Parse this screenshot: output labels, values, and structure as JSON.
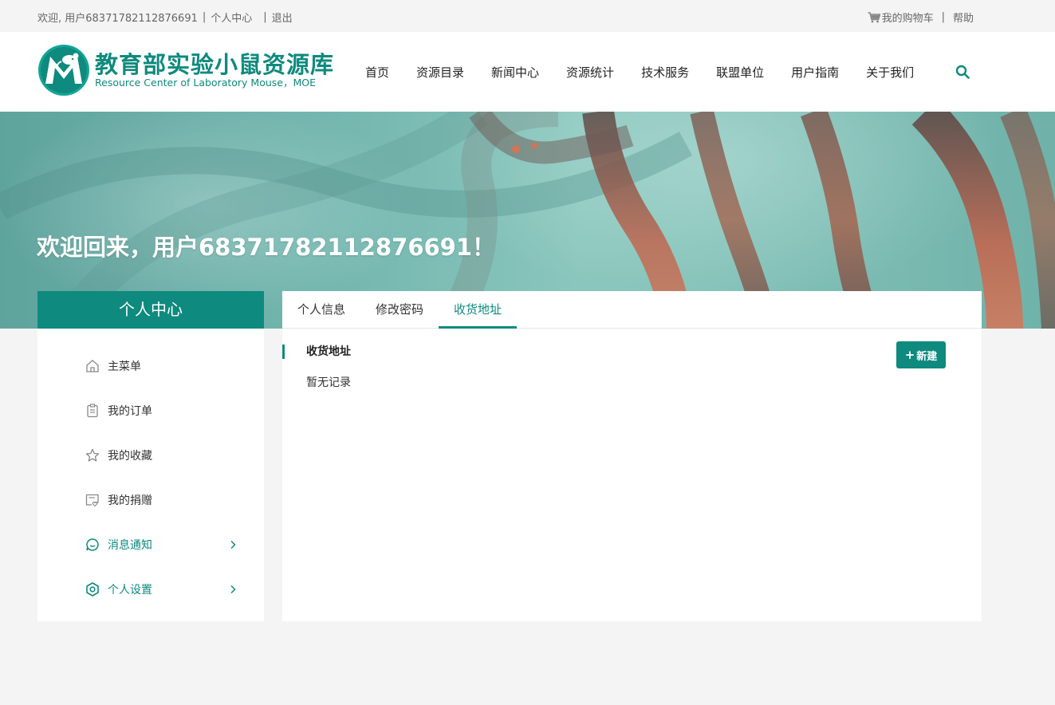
{
  "colors": {
    "accent": "#0e8a7e",
    "page_bg": "#f4f4f4",
    "panel_bg": "#ffffff"
  },
  "topbar": {
    "welcome": "欢迎, 用户68371782112876691",
    "sep": "|",
    "personal_center": "个人中心",
    "logout": "退出",
    "cart_icon": "cart-icon",
    "cart": "我的购物车",
    "help": "帮助"
  },
  "logo": {
    "cn": "教育部实验小鼠资源库",
    "en": "Resource Center of Laboratory Mouse，MOE"
  },
  "nav": {
    "items": [
      {
        "label": "首页"
      },
      {
        "label": "资源目录"
      },
      {
        "label": "新闻中心"
      },
      {
        "label": "资源统计"
      },
      {
        "label": "技术服务"
      },
      {
        "label": "联盟单位"
      },
      {
        "label": "用户指南"
      },
      {
        "label": "关于我们"
      }
    ],
    "search_icon": "search-icon"
  },
  "banner": {
    "title": "欢迎回来，用户68371782112876691！"
  },
  "sidebar": {
    "title": "个人中心",
    "items": [
      {
        "label": "主菜单",
        "icon": "home-icon",
        "highlight": false,
        "has_submenu": false
      },
      {
        "label": "我的订单",
        "icon": "clipboard-icon",
        "highlight": false,
        "has_submenu": false
      },
      {
        "label": "我的收藏",
        "icon": "star-icon",
        "highlight": false,
        "has_submenu": false
      },
      {
        "label": "我的捐赠",
        "icon": "donation-icon",
        "highlight": false,
        "has_submenu": false
      },
      {
        "label": "消息通知",
        "icon": "message-icon",
        "highlight": true,
        "has_submenu": true
      },
      {
        "label": "个人设置",
        "icon": "settings-icon",
        "highlight": true,
        "has_submenu": true
      }
    ]
  },
  "tabs": [
    {
      "label": "个人信息",
      "active": false
    },
    {
      "label": "修改密码",
      "active": false
    },
    {
      "label": "收货地址",
      "active": true
    }
  ],
  "main": {
    "section_title": "收货地址",
    "new_button": "新建",
    "new_button_icon": "plus-icon",
    "empty_text": "暂无记录"
  }
}
